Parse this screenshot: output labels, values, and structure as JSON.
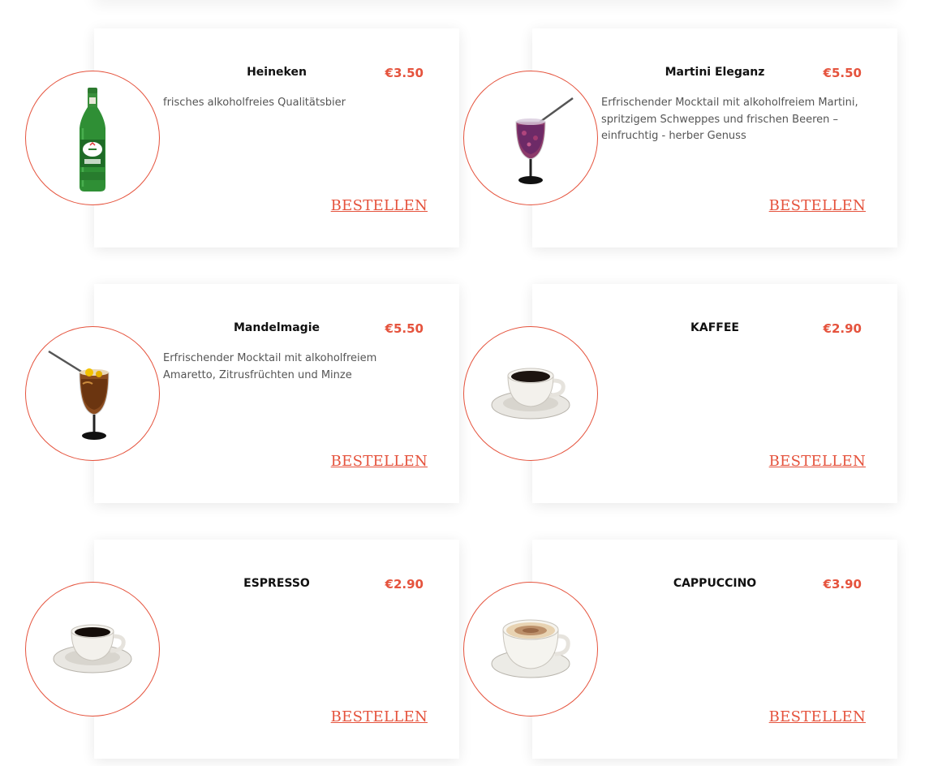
{
  "theme": {
    "accent": "#e5533d",
    "text": "#111111",
    "muted": "#555555"
  },
  "products": [
    {
      "name": "Heineken",
      "price": "€3.50",
      "description": "frisches alkoholfreies Qualitätsbier",
      "order_label": "BESTELLEN",
      "image_icon": "beer-bottle-icon"
    },
    {
      "name": "Martini Eleganz",
      "price": "€5.50",
      "description": "Erfrischender Mocktail mit alkoholfreiem Martini, spritzigem Schweppes und frischen Beeren – einfruchtig - herber Genuss",
      "order_label": "BESTELLEN",
      "image_icon": "berry-cocktail-icon"
    },
    {
      "name": "Mandelmagie",
      "price": "€5.50",
      "description": "Erfrischender Mocktail mit alkoholfreiem Amaretto, Zitrusfrüchten und Minze",
      "order_label": "BESTELLEN",
      "image_icon": "amaretto-cocktail-icon"
    },
    {
      "name": "KAFFEE",
      "price": "€2.90",
      "description": "",
      "order_label": "BESTELLEN",
      "image_icon": "coffee-cup-icon"
    },
    {
      "name": "ESPRESSO",
      "price": "€2.90",
      "description": "",
      "order_label": "BESTELLEN",
      "image_icon": "espresso-cup-icon"
    },
    {
      "name": "CAPPUCCINO",
      "price": "€3.90",
      "description": "",
      "order_label": "BESTELLEN",
      "image_icon": "cappuccino-cup-icon"
    }
  ]
}
